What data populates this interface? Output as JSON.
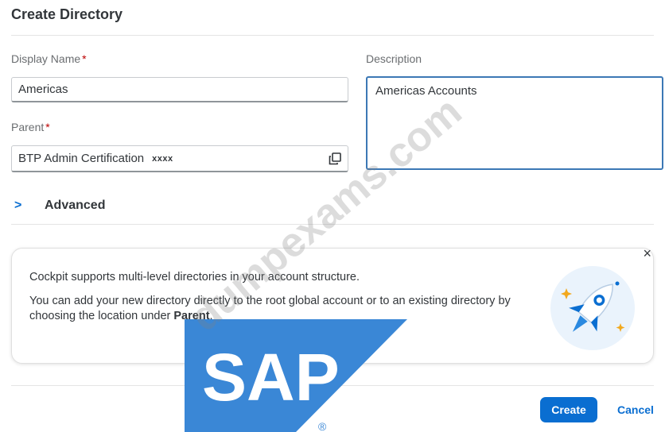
{
  "dialog": {
    "title": "Create Directory",
    "display_name": {
      "label": "Display Name",
      "required_mark": "*",
      "value": "Americas"
    },
    "parent": {
      "label": "Parent",
      "required_mark": "*",
      "value": "BTP Admin Certification",
      "masked_suffix": "xxxx",
      "icon": "value-help-icon"
    },
    "description": {
      "label": "Description",
      "value": "Americas Accounts"
    },
    "advanced": {
      "label": "Advanced",
      "icon": "chevron-right-icon"
    }
  },
  "info_strip": {
    "line1": "Cockpit supports multi-level directories in your account structure.",
    "line2_prefix": "You can add your new directory directly to the root global account or to an existing directory by choosing the location under ",
    "line2_bold": "Parent",
    "line2_suffix": ".",
    "close_label": "×",
    "illustration_icon": "rocket-icon"
  },
  "footer": {
    "create_label": "Create",
    "cancel_label": "Cancel"
  },
  "watermark": {
    "text": "dumpexams.com"
  },
  "logo": {
    "text": "SAP",
    "registered": "®"
  },
  "colors": {
    "accent": "#0a6ed1",
    "required": "#bb0000",
    "focus_border": "#3c78b5",
    "logo_blue": "#3a87d6"
  }
}
